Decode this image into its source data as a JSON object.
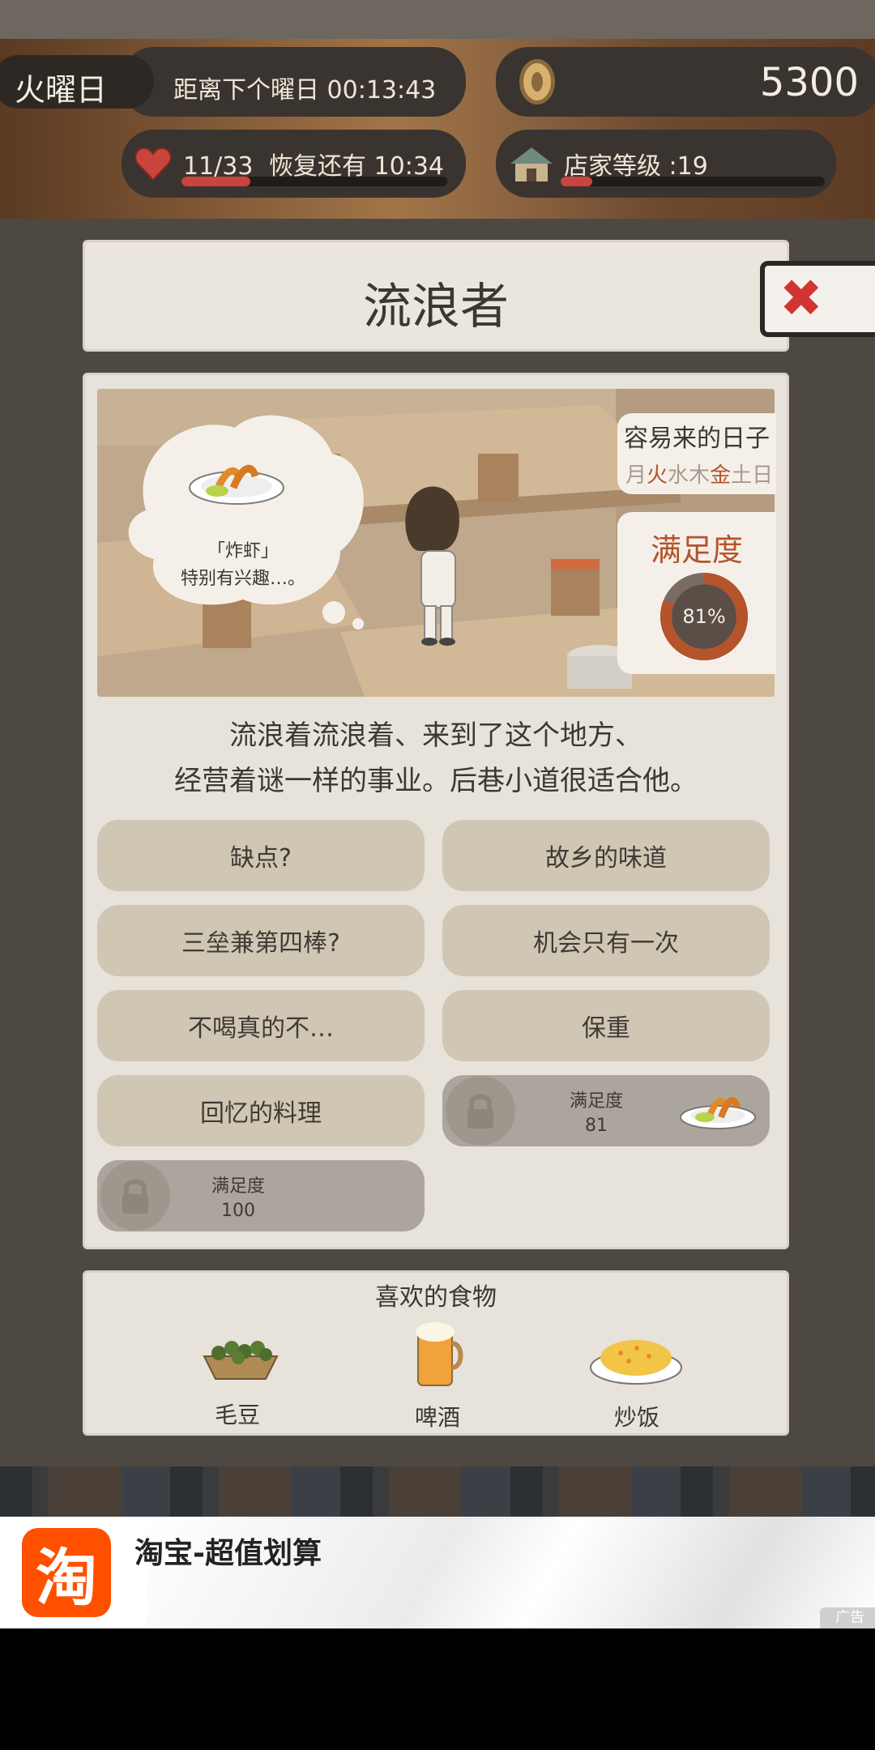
{
  "hud": {
    "day": "火曜日",
    "next_day_timer": "距离下个曜日 00:13:43",
    "coins": "5300",
    "stamina": "11/33",
    "stamina_recover": "恢复还有  10:34",
    "stamina_progress": 0.26,
    "shop_level": "店家等级 :19",
    "shop_progress": 0.12
  },
  "dialog": {
    "title": "流浪者",
    "close_icon": "close-icon",
    "bubble_food_line1": "「炸虾」",
    "bubble_food_line2": "特别有兴趣…。",
    "easy_days_title": "容易来的日子",
    "weekdays": [
      {
        "d": "月",
        "active": false
      },
      {
        "d": "火",
        "active": true
      },
      {
        "d": "水",
        "active": false
      },
      {
        "d": "木",
        "active": false
      },
      {
        "d": "金",
        "active": true
      },
      {
        "d": "土",
        "active": false
      },
      {
        "d": "日",
        "active": false
      }
    ],
    "satisfaction_title": "满足度",
    "satisfaction_value": 81,
    "satisfaction_label": "81%",
    "description_line1": "流浪着流浪着、来到了这个地方、",
    "description_line2": "经营着谜一样的事业。后巷小道很适合他。",
    "options": [
      "缺点?",
      "故乡的味道",
      "三垒兼第四棒?",
      "机会只有一次",
      "不喝真的不…",
      "保重",
      "回忆的料理"
    ],
    "locked_a_label": "满足度",
    "locked_a_value": "81",
    "locked_b_label": "满足度",
    "locked_b_value": "100"
  },
  "favorites": {
    "title": "喜欢的食物",
    "items": [
      "毛豆",
      "啤酒",
      "炒饭"
    ]
  },
  "ad": {
    "icon_char": "淘",
    "title": "淘宝-超值划算",
    "badge": "广告"
  },
  "colors": {
    "accent_red": "#c8443c",
    "satisfaction_ring": "#b5532a",
    "ad_orange": "#ff5000"
  }
}
